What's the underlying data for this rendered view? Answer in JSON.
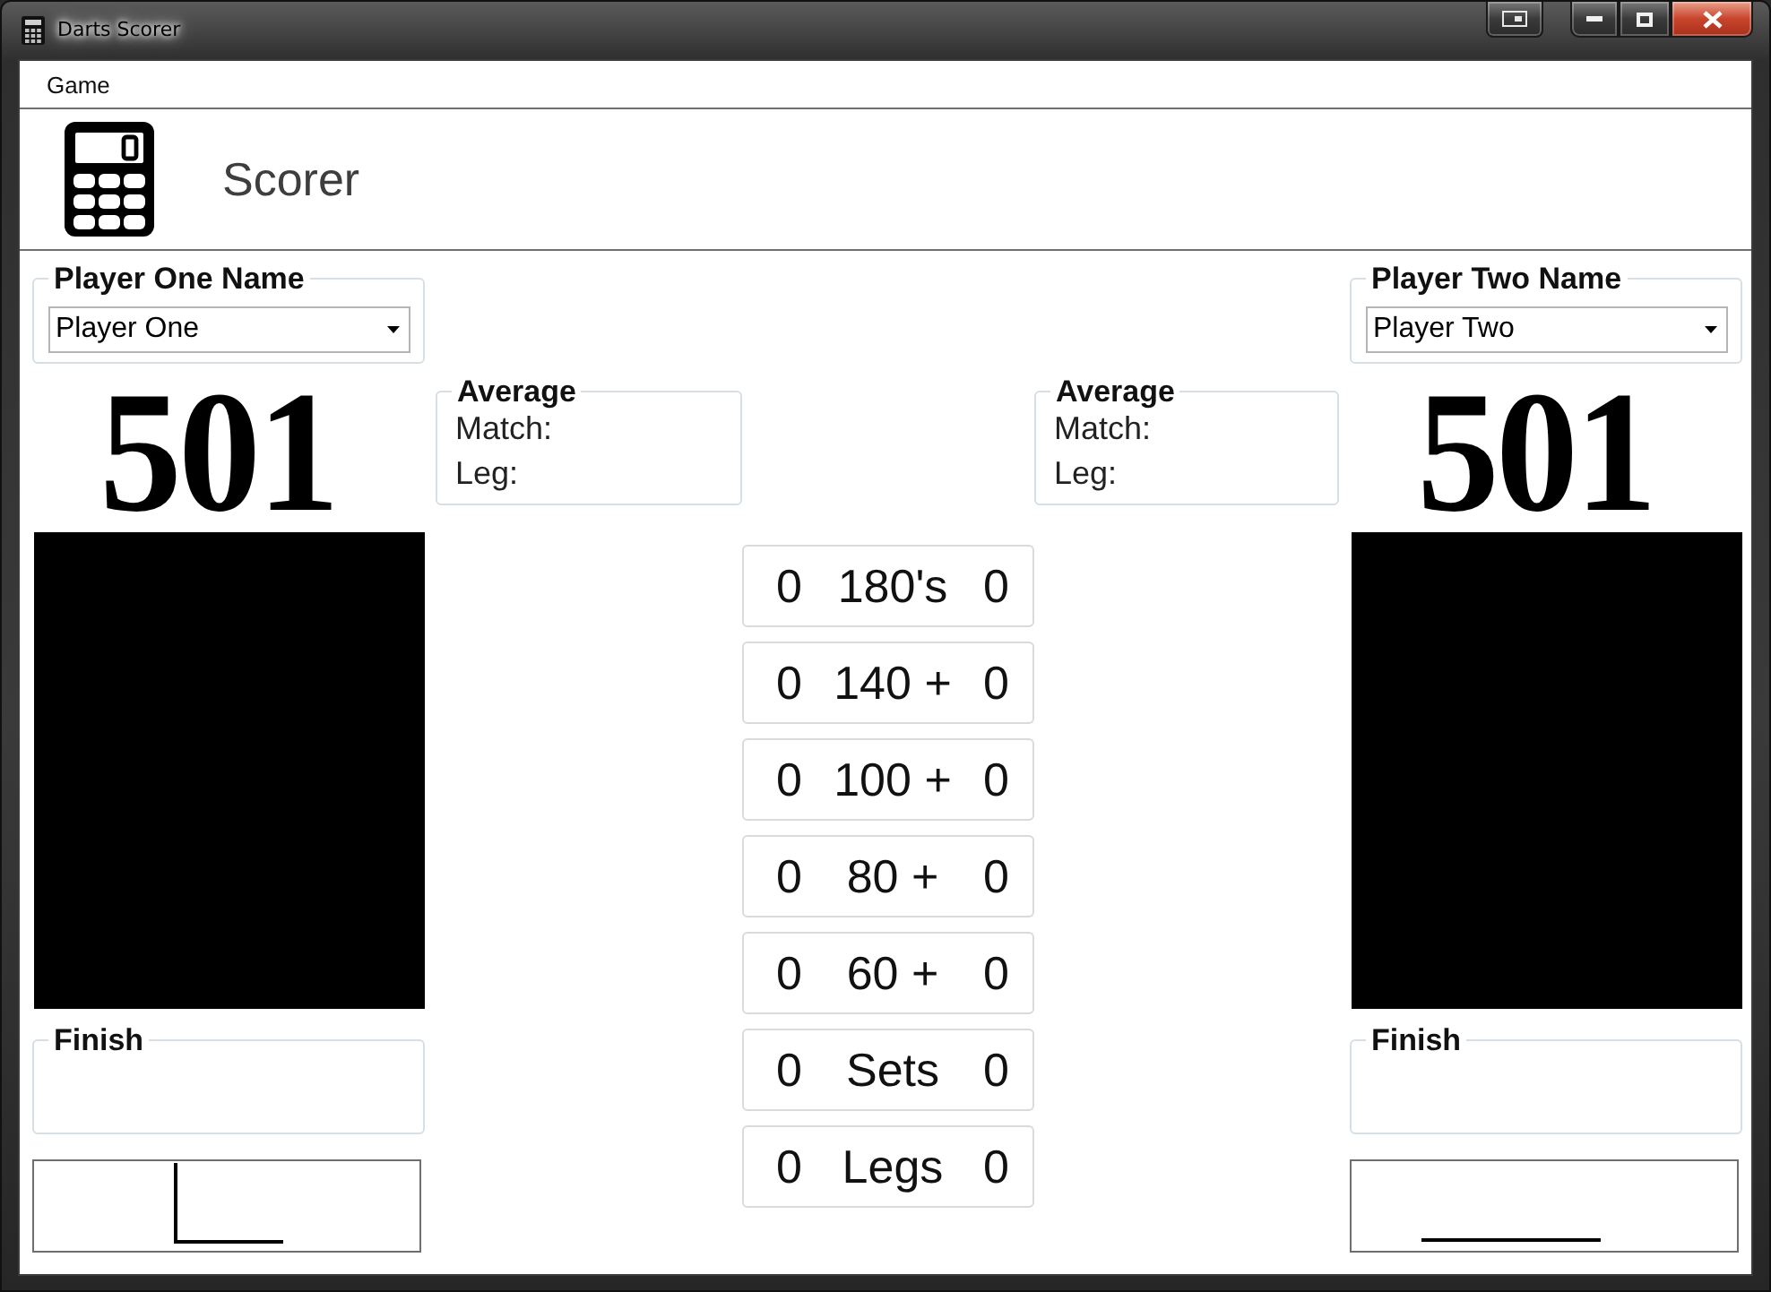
{
  "window": {
    "title": "Darts Scorer"
  },
  "menu": {
    "items": [
      {
        "label": "Game"
      }
    ]
  },
  "header": {
    "title": "Scorer"
  },
  "players": [
    {
      "name_label": "Player One Name",
      "name": "Player One",
      "score": "501",
      "average": {
        "title": "Average",
        "match_label": "Match:",
        "leg_label": "Leg:"
      },
      "finish_label": "Finish",
      "entry": {
        "focused": true
      }
    },
    {
      "name_label": "Player Two Name",
      "name": "Player Two",
      "score": "501",
      "average": {
        "title": "Average",
        "match_label": "Match:",
        "leg_label": "Leg:"
      },
      "finish_label": "Finish",
      "entry": {
        "focused": false
      }
    }
  ],
  "stats": [
    {
      "player_one": "0",
      "label": "180's",
      "player_two": "0"
    },
    {
      "player_one": "0",
      "label": "140 +",
      "player_two": "0"
    },
    {
      "player_one": "0",
      "label": "100 +",
      "player_two": "0"
    },
    {
      "player_one": "0",
      "label": "80 +",
      "player_two": "0"
    },
    {
      "player_one": "0",
      "label": "60 +",
      "player_two": "0"
    },
    {
      "player_one": "0",
      "label": "Sets",
      "player_two": "0"
    },
    {
      "player_one": "0",
      "label": "Legs",
      "player_two": "0"
    }
  ]
}
